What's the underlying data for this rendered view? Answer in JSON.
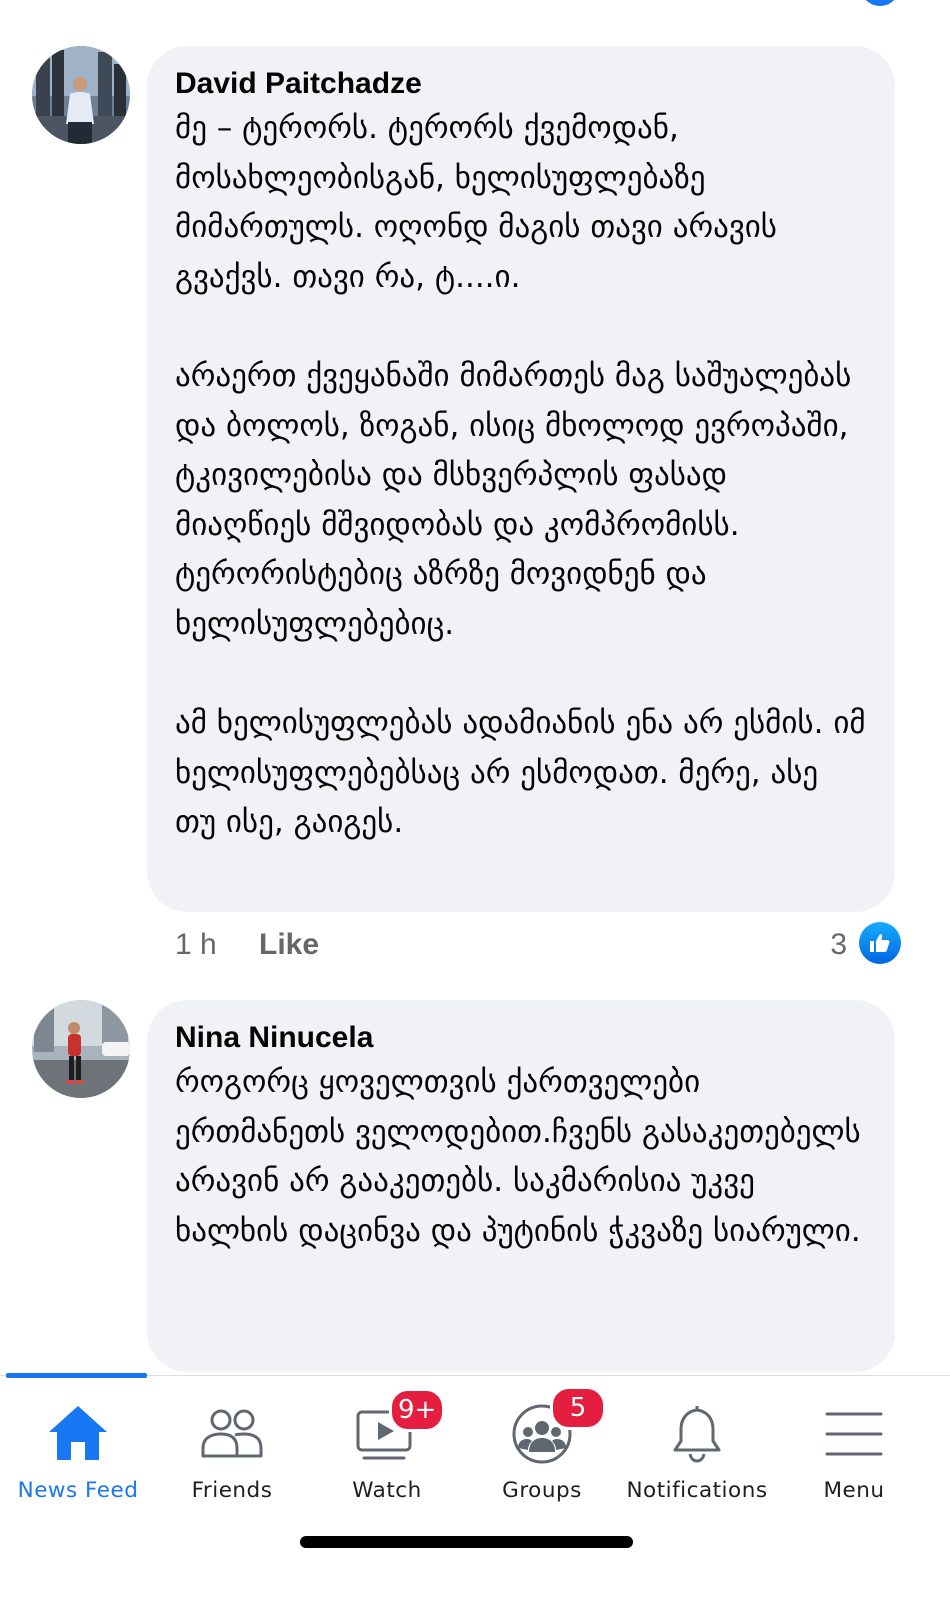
{
  "comments": [
    {
      "author": "David Paitchadze",
      "text": "მე – ტერორს. ტერორს ქვემოდან, მოსახლეობისგან, ხელისუფლებაზე მიმართულს. ოღონდ მაგის თავი არავის გვაქვს. თავი რა, ტ....ი.\n\nარაერთ ქვეყანაში მიმართეს მაგ საშუალებას და ბოლოს, ზოგან, ისიც მხოლოდ ევროპაში, ტკივილებისა და მსხვერპლის ფასად მიაღწიეს მშვიდობას და კომპრომისს. ტერორისტებიც აზრზე მოვიდნენ და ხელისუფლებებიც.\n\nამ ხელისუფლებას ადამიანის ენა არ ესმის. იმ ხელისუფლებებსაც არ ესმოდათ. მერე, ასე თუ ისე, გაიგეს.",
      "time": "1 h",
      "like_label": "Like",
      "reaction_count": "3"
    },
    {
      "author": "Nina Ninucela",
      "text": "როგორც ყოველთვის ქართველები ერთმანეთს ველოდებით.ჩვენს გასაკეთებელს არავინ არ გააკეთებს. საკმარისია უკვე ხალხის დაცინვა და პუტინის ჭკვაზე სიარული."
    }
  ],
  "tabbar": {
    "tabs": [
      {
        "label": "News Feed",
        "icon": "home-icon",
        "active": true
      },
      {
        "label": "Friends",
        "icon": "friends-icon"
      },
      {
        "label": "Watch",
        "icon": "watch-icon",
        "badge": "9+"
      },
      {
        "label": "Groups",
        "icon": "groups-icon",
        "badge": "5"
      },
      {
        "label": "Notifications",
        "icon": "bell-icon"
      },
      {
        "label": "Menu",
        "icon": "menu-icon"
      }
    ]
  },
  "colors": {
    "accent": "#1877f2",
    "bubble": "#f0f2f5",
    "badge": "#e41e3f",
    "meta_text": "#65676b"
  }
}
